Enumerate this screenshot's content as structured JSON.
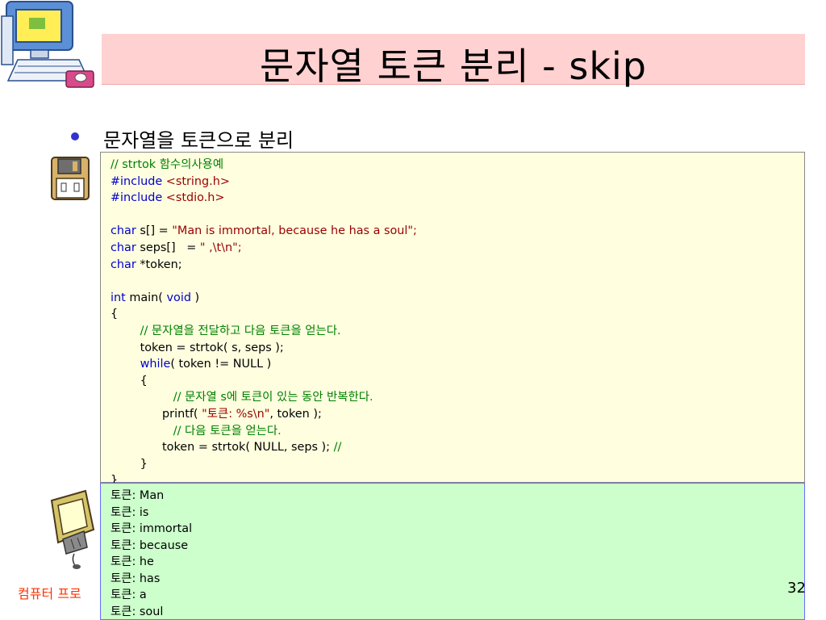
{
  "slide": {
    "title": "문자열 토큰 분리 - skip",
    "subheading": "문자열을 토큰으로 분리",
    "footer": "컴퓨터 프로",
    "page_number": "32"
  },
  "code": [
    [
      {
        "t": "// strtok ",
        "c": "cm"
      },
      {
        "t": "함수의사용예",
        "c": "cm"
      }
    ],
    [
      {
        "t": "#include ",
        "c": "kw"
      },
      {
        "t": "<string.h>",
        "c": "str"
      }
    ],
    [
      {
        "t": "#include ",
        "c": "kw"
      },
      {
        "t": "<stdio.h>",
        "c": "str"
      }
    ],
    [],
    [
      {
        "t": "char ",
        "c": "kw"
      },
      {
        "t": "s[] = ",
        "c": "pl"
      },
      {
        "t": "\"Man is immortal, because he has a soul\";",
        "c": "str"
      }
    ],
    [
      {
        "t": "char ",
        "c": "kw"
      },
      {
        "t": "seps[]   = ",
        "c": "pl"
      },
      {
        "t": "\" ,\\t\\n\";",
        "c": "str"
      }
    ],
    [
      {
        "t": "char ",
        "c": "kw"
      },
      {
        "t": "*token;",
        "c": "pl"
      }
    ],
    [],
    [
      {
        "t": "int ",
        "c": "kw"
      },
      {
        "t": "main( ",
        "c": "pl"
      },
      {
        "t": "void ",
        "c": "kw"
      },
      {
        "t": ")",
        "c": "pl"
      }
    ],
    [
      {
        "t": "{",
        "c": "pl"
      }
    ],
    [
      {
        "t": "        // 문자열을 전달하고 다음 토큰을 얻는다.",
        "c": "cm"
      }
    ],
    [
      {
        "t": "        token = strtok( s, seps );",
        "c": "pl"
      }
    ],
    [
      {
        "t": "        while",
        "c": "kw"
      },
      {
        "t": "( token != NULL )",
        "c": "pl"
      }
    ],
    [
      {
        "t": "        {",
        "c": "pl"
      }
    ],
    [
      {
        "t": "                 // 문자열 ",
        "c": "cm"
      },
      {
        "t": "s",
        "c": "cm"
      },
      {
        "t": "에 토큰이 있는 동안 반복한다.",
        "c": "cm"
      }
    ],
    [
      {
        "t": "              printf( ",
        "c": "pl"
      },
      {
        "t": "\"토큰: %s\\n\"",
        "c": "str"
      },
      {
        "t": ", token );",
        "c": "pl"
      }
    ],
    [
      {
        "t": "                 // 다음 토큰을 얻는다.",
        "c": "cm"
      }
    ],
    [
      {
        "t": "              token = strtok( NULL, seps ); ",
        "c": "pl"
      },
      {
        "t": "//",
        "c": "cm"
      }
    ],
    [
      {
        "t": "        }",
        "c": "pl"
      }
    ],
    [
      {
        "t": "}",
        "c": "pl"
      }
    ]
  ],
  "output": [
    "토큰: Man",
    "토큰: is",
    "토큰: immortal",
    "토큰: because",
    "토큰: he",
    "토큰: has",
    "토큰: a",
    "토큰: soul"
  ],
  "icons": {
    "computer": "computer-clipart-icon",
    "floppy": "floppy-disk-icon",
    "monitor": "monitor-clipart-icon"
  },
  "colors": {
    "title_bg": "#ffd1d1",
    "code_bg": "#ffffe0",
    "output_bg": "#ccffcc",
    "comment": "#008000",
    "keyword": "#0000cc",
    "string": "#990000",
    "footer": "#ff3300",
    "bullet": "#3333cc"
  }
}
